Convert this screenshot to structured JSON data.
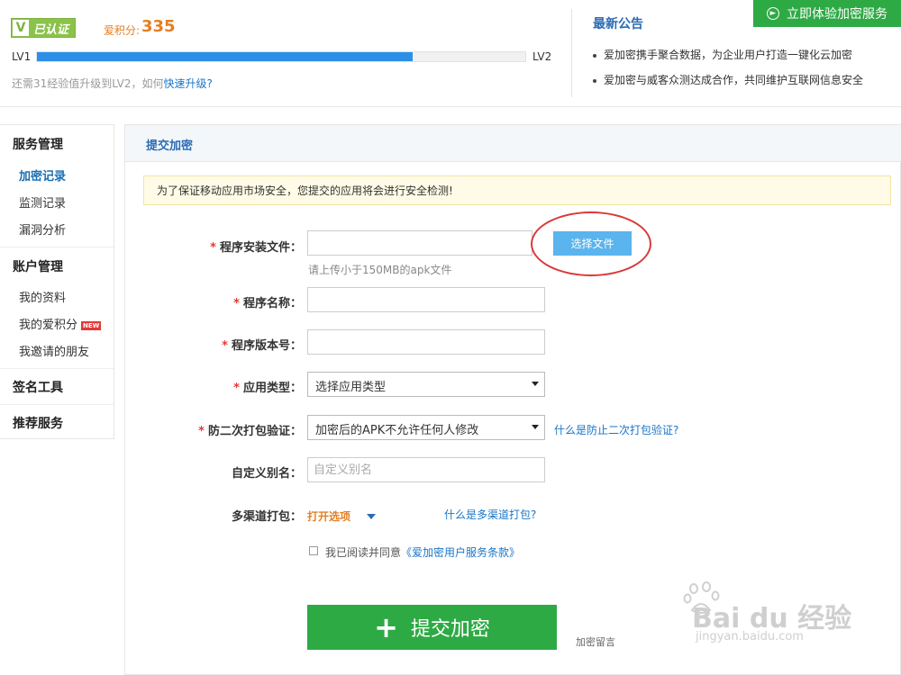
{
  "header": {
    "verified_badge": "已认证",
    "score_label": "爱积分:",
    "score_value": "335",
    "level_from": "LV1",
    "level_to": "LV2",
    "level_progress": 0.77,
    "upgrade_hint": "还需31经验值升级到LV2，如何",
    "upgrade_link": "快速升级?",
    "notice_title": "最新公告",
    "notices": [
      "爱加密携手聚合数据，为企业用户打造一键化云加密",
      "爱加密与威客众测达成合作，共同维护互联网信息安全"
    ],
    "try_button": "立即体验加密服务"
  },
  "sidebar": {
    "groups": [
      {
        "title": "服务管理",
        "items": [
          "加密记录",
          "监测记录",
          "漏洞分析"
        ]
      },
      {
        "title": "账户管理",
        "items": [
          "我的资料",
          "我的爱积分",
          "我邀请的朋友"
        ]
      },
      {
        "title": "签名工具",
        "items": []
      },
      {
        "title": "推荐服务",
        "items": []
      }
    ],
    "new_badge": "NEW"
  },
  "main": {
    "title": "提交加密",
    "warning": "为了保证移动应用市场安全，您提交的应用将会进行安全检测!",
    "form": {
      "file_label": "程序安装文件：",
      "file_button": "选择文件",
      "file_hint": "请上传小于150MB的apk文件",
      "name_label": "程序名称：",
      "version_label": "程序版本号：",
      "type_label": "应用类型：",
      "type_value": "选择应用类型",
      "repack_label": "防二次打包验证：",
      "repack_value": "加密后的APK不允许任何人修改",
      "repack_help": "什么是防止二次打包验证?",
      "alias_label": "自定义别名：",
      "alias_placeholder": "自定义别名",
      "channel_label": "多渠道打包：",
      "channel_open": "打开选项",
      "channel_help": "什么是多渠道打包?",
      "agree_text": "我已阅读并同意",
      "agree_terms": "《爱加密用户服务条款》",
      "submit": "提交加密",
      "note_link": "加密留言"
    }
  },
  "watermark": {
    "brand": "Bai du 经验",
    "url": "jingyan.baidu.com"
  },
  "colors": {
    "brand_green": "#2eaa45",
    "link_blue": "#1a75c7",
    "progress_blue": "#2e8fe8",
    "accent_orange": "#e67e22",
    "highlight_red": "#d9393a"
  }
}
